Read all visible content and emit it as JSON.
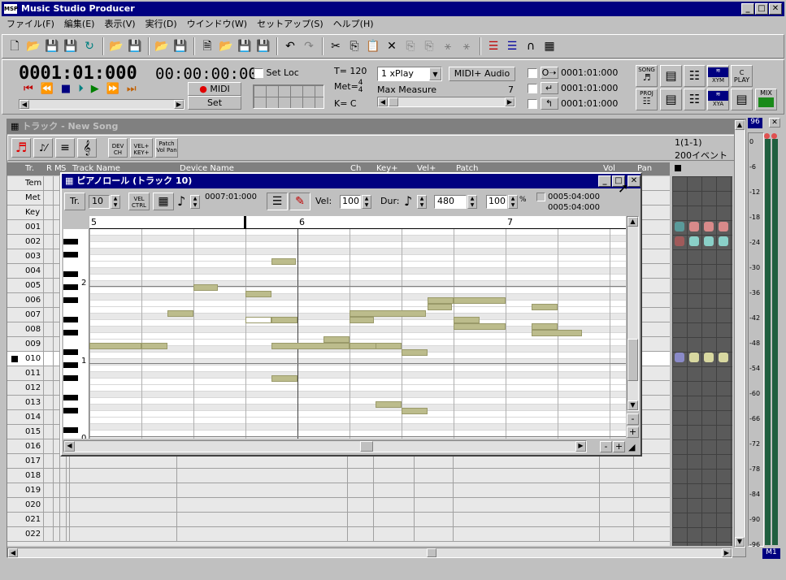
{
  "app": {
    "title": "Music Studio Producer",
    "icon": "app-icon"
  },
  "menu": [
    "ファイル(F)",
    "編集(E)",
    "表示(V)",
    "実行(D)",
    "ウインドウ(W)",
    "セットアップ(S)",
    "ヘルプ(H)"
  ],
  "transport": {
    "position": "0001:01:000",
    "time": "00:00:00:00",
    "set_loc": "Set Loc",
    "tempo": "T= 120",
    "met_label": "Met=",
    "met_num": "4",
    "met_den": "4",
    "key": "K=  C",
    "midi_button": "MIDI",
    "set_button": "Set",
    "play_mode": "1 xPlay",
    "midi_audio": "MIDI+ Audio",
    "max_measure_label": "Max Measure",
    "max_measure_value": "7",
    "loc1": "0001:01:000",
    "loc2": "0001:01:000",
    "loc3": "0001:01:000"
  },
  "right_buttons": [
    "SONG",
    "PROJ",
    "C PLAY",
    "MIX",
    "XYM",
    "XYA"
  ],
  "track_window": {
    "title": "トラック - New Song",
    "buttons": [
      "DEV CH",
      "VEL+ KEY+",
      "Patch Vol Pan"
    ],
    "event_pos": "1(1-1)",
    "event_count": "200イベント",
    "columns": [
      "Tr.",
      "R",
      "M",
      "S",
      "Track Name",
      "Device Name",
      "Ch",
      "Key+",
      "Vel+",
      "Patch",
      "Vol",
      "Pan"
    ],
    "rows": [
      "Tem",
      "Met",
      "Key",
      "001",
      "002",
      "003",
      "004",
      "005",
      "006",
      "007",
      "008",
      "009",
      "010",
      "011",
      "012",
      "013",
      "014",
      "015",
      "016",
      "017",
      "018",
      "019",
      "020",
      "021",
      "022"
    ],
    "selected_row": "010"
  },
  "pianoroll": {
    "title": "ピアノロール (トラック 10)",
    "tr_label": "Tr.",
    "tr_value": "10",
    "vel_ctrl": "VEL CTRL",
    "position": "0007:01:000",
    "vel_label": "Vel:",
    "vel_value": "100",
    "dur_label": "Dur:",
    "dur_value": "480",
    "pct_value": "100",
    "pct_sign": "%",
    "end_pos1": "0005:04:000",
    "end_pos2": "0005:04:000",
    "measures": [
      "5",
      "6",
      "7"
    ],
    "octave_labels": [
      "2",
      "1",
      "0"
    ]
  },
  "mixer": {
    "level_top": "96",
    "meter_label": "M1",
    "db_ticks": [
      "0",
      "-6",
      "-12",
      "-18",
      "-24",
      "-30",
      "-36",
      "-42",
      "-48",
      "-54",
      "-60",
      "-66",
      "-72",
      "-78",
      "-84",
      "-90",
      "-96"
    ]
  },
  "colors": {
    "title_active": "#000080",
    "note": "#bcbc8c",
    "desktop": "#c0c0c0",
    "track_header": "#808080"
  }
}
